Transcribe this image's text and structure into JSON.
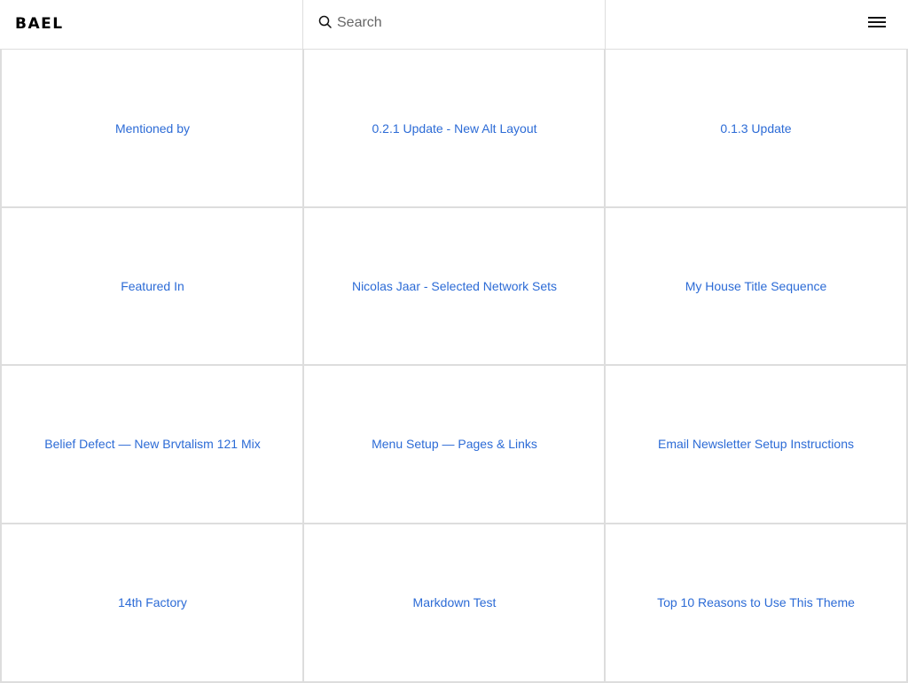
{
  "header": {
    "brand": "BAEL",
    "search_placeholder": "Search",
    "search_value": ""
  },
  "icons": {
    "search": "search-icon",
    "menu": "hamburger-menu-icon"
  },
  "colors": {
    "link": "#2c6bd6",
    "border": "#dddddd",
    "text": "#000000"
  },
  "posts": [
    {
      "title": "Mentioned by"
    },
    {
      "title": "0.2.1 Update - New Alt Layout"
    },
    {
      "title": "0.1.3 Update"
    },
    {
      "title": "Featured In"
    },
    {
      "title": "Nicolas Jaar - Selected Network Sets"
    },
    {
      "title": "My House Title Sequence"
    },
    {
      "title": "Belief Defect — New Brvtalism 121 Mix"
    },
    {
      "title": "Menu Setup — Pages & Links"
    },
    {
      "title": "Email Newsletter Setup Instructions"
    },
    {
      "title": "14th Factory"
    },
    {
      "title": "Markdown Test"
    },
    {
      "title": "Top 10 Reasons to Use This Theme"
    }
  ]
}
